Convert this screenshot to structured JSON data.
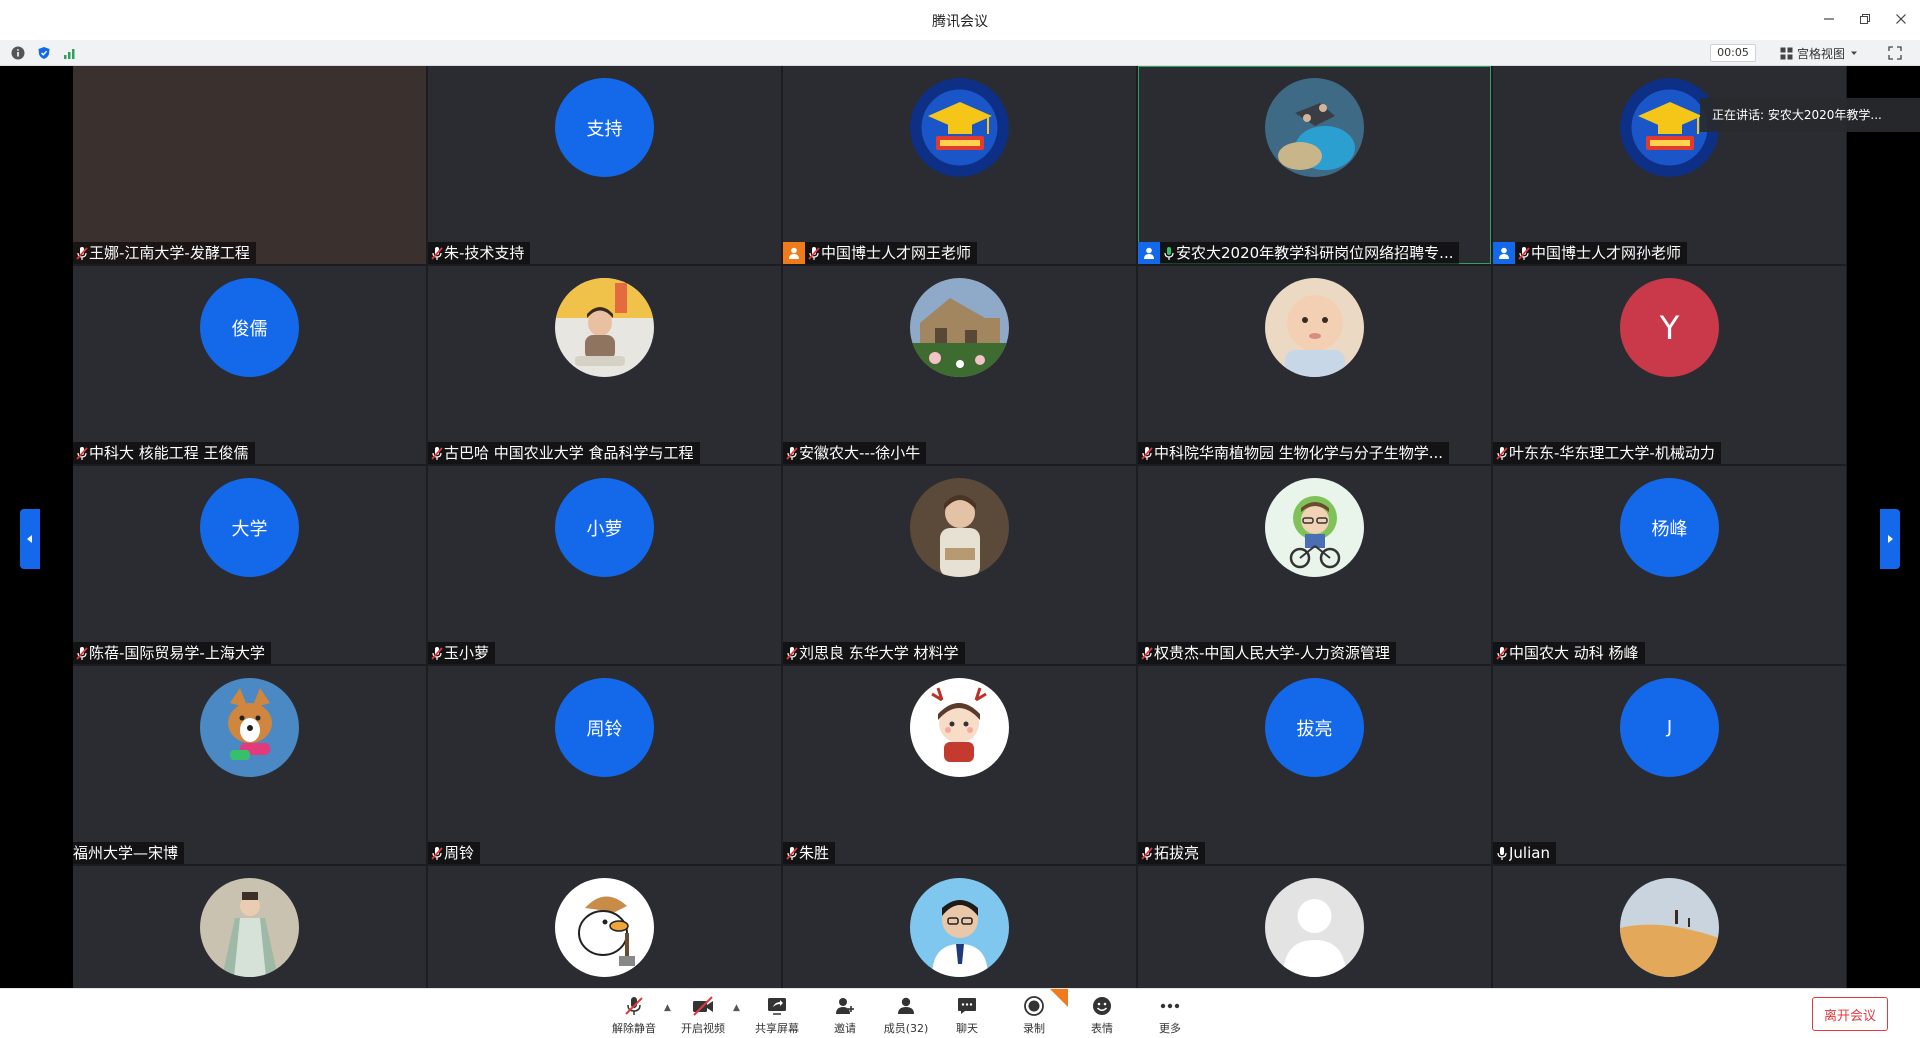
{
  "window": {
    "title": "腾讯会议"
  },
  "toolbar": {
    "timer": "00:05",
    "view_label": "宫格视图"
  },
  "speaking_banner": "正在讲话: 安农大2020年教学...",
  "participants": [
    {
      "name": "王娜-江南大学-发酵工程",
      "mic": "muted",
      "avatar": {
        "kind": "video"
      }
    },
    {
      "name": "朱-技术支持",
      "mic": "muted",
      "avatar": {
        "kind": "text",
        "text": "支持",
        "color": "#1369ea"
      }
    },
    {
      "name": "中国博士人才网王老师",
      "mic": "muted",
      "host_badge": "orange",
      "avatar": {
        "kind": "image",
        "icon": "graduation-cap-logo"
      }
    },
    {
      "name": "安农大2020年教学科研岗位网络招聘专...",
      "mic": "active",
      "host_badge": "blue",
      "speaking": true,
      "avatar": {
        "kind": "image",
        "icon": "skydiving-photo"
      }
    },
    {
      "name": "中国博士人才网孙老师",
      "mic": "muted",
      "host_badge": "blue",
      "avatar": {
        "kind": "image",
        "icon": "graduation-cap-logo"
      }
    },
    {
      "name": "中科大 核能工程 王俊儒",
      "mic": "muted",
      "avatar": {
        "kind": "text",
        "text": "俊儒",
        "color": "#1369ea"
      }
    },
    {
      "name": "古巴哈  中国农业大学  食品科学与工程",
      "mic": "muted",
      "avatar": {
        "kind": "image",
        "icon": "child-photo"
      }
    },
    {
      "name": "安徽农大---徐小牛",
      "mic": "muted",
      "avatar": {
        "kind": "image",
        "icon": "house-garden-photo"
      }
    },
    {
      "name": "中科院华南植物园 生物化学与分子生物学...",
      "mic": "muted",
      "avatar": {
        "kind": "image",
        "icon": "baby-photo"
      }
    },
    {
      "name": "叶东东-华东理工大学-机械动力",
      "mic": "muted",
      "avatar": {
        "kind": "text",
        "text": "Y",
        "color": "#c9394a"
      }
    },
    {
      "name": "陈蓓-国际贸易学-上海大学",
      "mic": "muted",
      "avatar": {
        "kind": "text",
        "text": "大学",
        "color": "#1369ea"
      }
    },
    {
      "name": "玉小萝",
      "mic": "muted",
      "avatar": {
        "kind": "text",
        "text": "小萝",
        "color": "#1369ea"
      }
    },
    {
      "name": "刘思良 东华大学 材料学",
      "mic": "muted",
      "avatar": {
        "kind": "image",
        "icon": "painting-girl-photo"
      }
    },
    {
      "name": "权贵杰-中国人民大学-人力资源管理",
      "mic": "muted",
      "avatar": {
        "kind": "image",
        "icon": "cartoon-cyclist"
      }
    },
    {
      "name": "中国农大 动科 杨峰",
      "mic": "muted",
      "avatar": {
        "kind": "text",
        "text": "杨峰",
        "color": "#1369ea"
      }
    },
    {
      "name": "福州大学—宋博",
      "mic": "none",
      "avatar": {
        "kind": "image",
        "icon": "corgi-photo"
      }
    },
    {
      "name": "周铃",
      "mic": "muted",
      "avatar": {
        "kind": "text",
        "text": "周铃",
        "color": "#1369ea"
      }
    },
    {
      "name": "朱胜",
      "mic": "muted",
      "avatar": {
        "kind": "image",
        "icon": "cartoon-girl-antlers"
      }
    },
    {
      "name": "拓拔亮",
      "mic": "muted",
      "avatar": {
        "kind": "text",
        "text": "拔亮",
        "color": "#1369ea"
      }
    },
    {
      "name": "Julian",
      "mic": "on",
      "avatar": {
        "kind": "text",
        "text": "J",
        "color": "#1369ea"
      }
    },
    {
      "name": "",
      "mic": "none",
      "avatar": {
        "kind": "image",
        "icon": "traditional-dress-photo"
      }
    },
    {
      "name": "",
      "mic": "none",
      "avatar": {
        "kind": "image",
        "icon": "cartoon-duck"
      }
    },
    {
      "name": "",
      "mic": "none",
      "avatar": {
        "kind": "image",
        "icon": "man-portrait-photo"
      }
    },
    {
      "name": "",
      "mic": "none",
      "avatar": {
        "kind": "image",
        "icon": "default-user-silhouette"
      }
    },
    {
      "name": "",
      "mic": "none",
      "avatar": {
        "kind": "image",
        "icon": "desert-photo"
      }
    }
  ],
  "controls": {
    "unmute": "解除静音",
    "start_video": "开启视频",
    "share_screen": "共享屏幕",
    "invite": "邀请",
    "members": "成员(32)",
    "chat": "聊天",
    "record": "录制",
    "reactions": "表情",
    "more": "更多",
    "leave": "离开会议"
  },
  "colors": {
    "accent": "#1369ea",
    "speaking": "#2fa35a",
    "danger": "#e0393e",
    "host_orange": "#f07b1a"
  }
}
